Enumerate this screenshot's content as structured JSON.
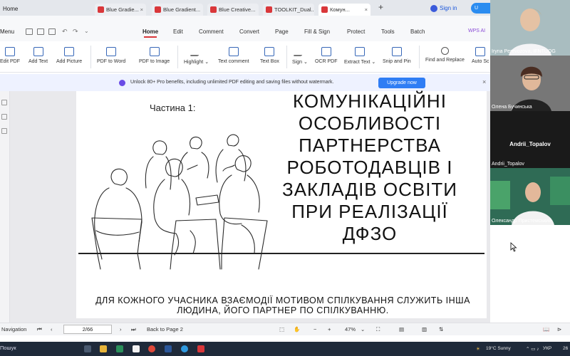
{
  "tabs": {
    "home": "Home",
    "files": [
      {
        "label": "Blue Gradie...",
        "active": false
      },
      {
        "label": "Blue Gradient...",
        "active": false
      },
      {
        "label": "Blue Creative...",
        "active": false
      },
      {
        "label": "TOOLKIT_Dual...",
        "active": false
      },
      {
        "label": "Комун...",
        "active": true
      }
    ],
    "sign_in": "Sign in",
    "upgrade": "U"
  },
  "menubar": {
    "menu": "Menu",
    "tabs": [
      "Home",
      "Edit",
      "Comment",
      "Convert",
      "Page",
      "Fill & Sign",
      "Protect",
      "Tools",
      "Batch"
    ],
    "active_tab": "Home",
    "wps_ai": "WPS AI"
  },
  "ribbon": {
    "tools": [
      "Edit PDF",
      "Add Text",
      "Add Picture",
      "PDF to Word",
      "PDF to Image",
      "Highlight",
      "Text comment",
      "Text Box",
      "Sign",
      "OCR PDF",
      "Extract Text",
      "Snip and Pin",
      "Find and Replace",
      "Auto Sc"
    ]
  },
  "banner": {
    "text": "Unlock 80+ Pro benefits, including unlimited PDF editing and saving files without watermark.",
    "button": "Upgrade now"
  },
  "slide": {
    "part_label": "Частина 1:",
    "title_lines": [
      "КОМУНІКАЦІЙНІ",
      "ОСОБЛИВОСТІ",
      "ПАРТНЕРСТВА",
      "РОБОТОДАВЦІВ І",
      "ЗАКЛАДІВ ОСВІТИ",
      "ПРИ РЕАЛІЗАЦІЇ",
      "ДФЗО"
    ],
    "caption": "ДЛЯ КОЖНОГО УЧАСНИКА ВЗАЄМОДІЇ МОТИВОМ СПІЛКУВАННЯ СЛУЖИТЬ ІНША ЛЮДИНА, ЙОГО ПАРТНЕР ПО СПІЛКУВАННЮ."
  },
  "statusbar": {
    "navigation": "Navigation",
    "page": "2/66",
    "back_to_page": "Back to Page 2",
    "zoom": "47%"
  },
  "taskbar": {
    "search": "Пошук",
    "weather": "19°C  Sunny",
    "lang": "УКР",
    "time": "26"
  },
  "video": {
    "participants": [
      {
        "name": "Iryna Perevozova, IFNTUOG"
      },
      {
        "name": "Олена Бучинська"
      },
      {
        "name": "Andrii_Topalov",
        "center_label": "Andrii_Topalov"
      },
      {
        "name": "Олександр Пристемський"
      }
    ]
  }
}
